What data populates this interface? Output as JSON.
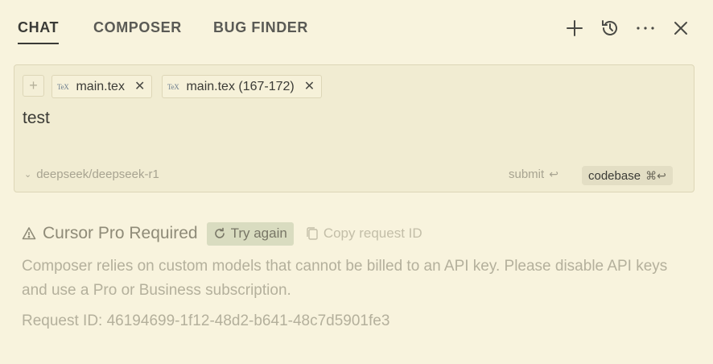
{
  "tabs": [
    {
      "label": "CHAT",
      "active": true
    },
    {
      "label": "COMPOSER",
      "active": false
    },
    {
      "label": "BUG FINDER",
      "active": false
    }
  ],
  "top_actions": [
    "plus-icon",
    "history-icon",
    "more-icon",
    "close-icon"
  ],
  "composer": {
    "add_context_label": "+",
    "context_pills": [
      {
        "icon_text": "TeX",
        "label": "main.tex"
      },
      {
        "icon_text": "TeX",
        "label": "main.tex (167-172)"
      }
    ],
    "prompt_text": "test",
    "model": "deepseek/deepseek-r1",
    "submit_label": "submit",
    "submit_shortcut": "↩",
    "codebase_label": "codebase",
    "codebase_shortcut": "⌘↩"
  },
  "error": {
    "title": "Cursor Pro Required",
    "try_again_label": "Try again",
    "copy_request_label": "Copy request ID",
    "message": "Composer relies on custom models that cannot be billed to an API key. Please disable API keys and use a Pro or Business subscription.",
    "request_id_text": "Request ID: 46194699-1f12-48d2-b641-48c7d5901fe3"
  },
  "colors": {
    "background": "#f8f3dd",
    "panel": "#f1ecd2",
    "try_again_bg": "#d9dcc0",
    "muted_text": "#b4b09c"
  }
}
